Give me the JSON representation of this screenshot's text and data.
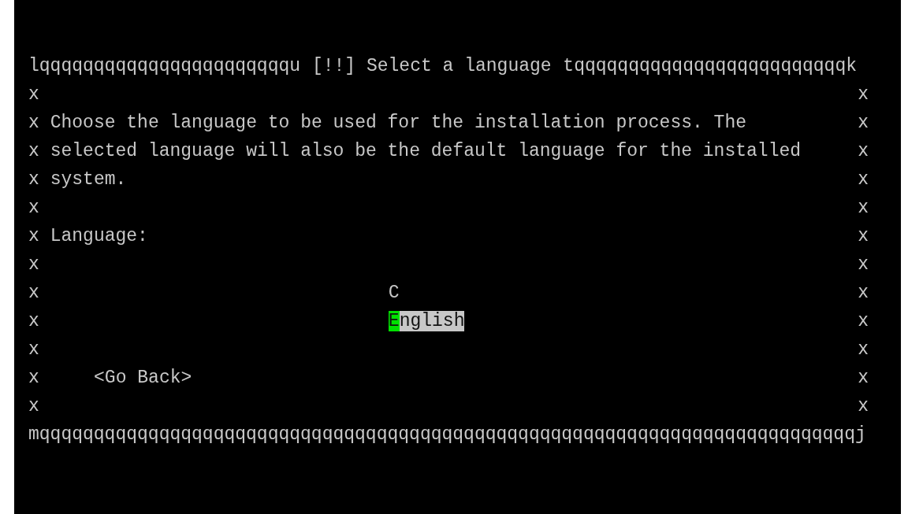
{
  "dialog": {
    "frame_top": {
      "left": "lqqqqqqqqqqqqqqqqqqqqqqqu",
      "title": "[!!] Select a language",
      "right": "tqqqqqqqqqqqqqqqqqqqqqqqqqk"
    },
    "rows": [
      {
        "kind": "blank",
        "left": "x",
        "right": "x"
      },
      {
        "kind": "text",
        "left": "x",
        "right": "x",
        "text": "Choose the language to be used for the installation process. The"
      },
      {
        "kind": "text",
        "left": "x",
        "right": "x",
        "text": "selected language will also be the default language for the installed"
      },
      {
        "kind": "text",
        "left": "x",
        "right": "x",
        "text": "system."
      },
      {
        "kind": "blank",
        "left": "x",
        "right": "x"
      },
      {
        "kind": "text",
        "left": "x",
        "right": "x",
        "text": "Language:"
      },
      {
        "kind": "blank",
        "left": "x",
        "right": "x"
      },
      {
        "kind": "list_item",
        "left": "x",
        "right": "x",
        "label": "C",
        "selected": false
      },
      {
        "kind": "list_item",
        "left": "x",
        "right": "x",
        "label": "English",
        "selected": true
      },
      {
        "kind": "blank",
        "left": "x",
        "right": "x"
      },
      {
        "kind": "button",
        "left": "x",
        "right": "x",
        "label": "<Go Back>"
      },
      {
        "kind": "blank",
        "left": "x",
        "right": "x"
      }
    ],
    "frame_bottom": "mqqqqqqqqqqqqqqqqqqqqqqqqqqqqqqqqqqqqqqqqqqqqqqqqqqqqqqqqqqqqqqqqqqqqqqqqqqqj"
  }
}
